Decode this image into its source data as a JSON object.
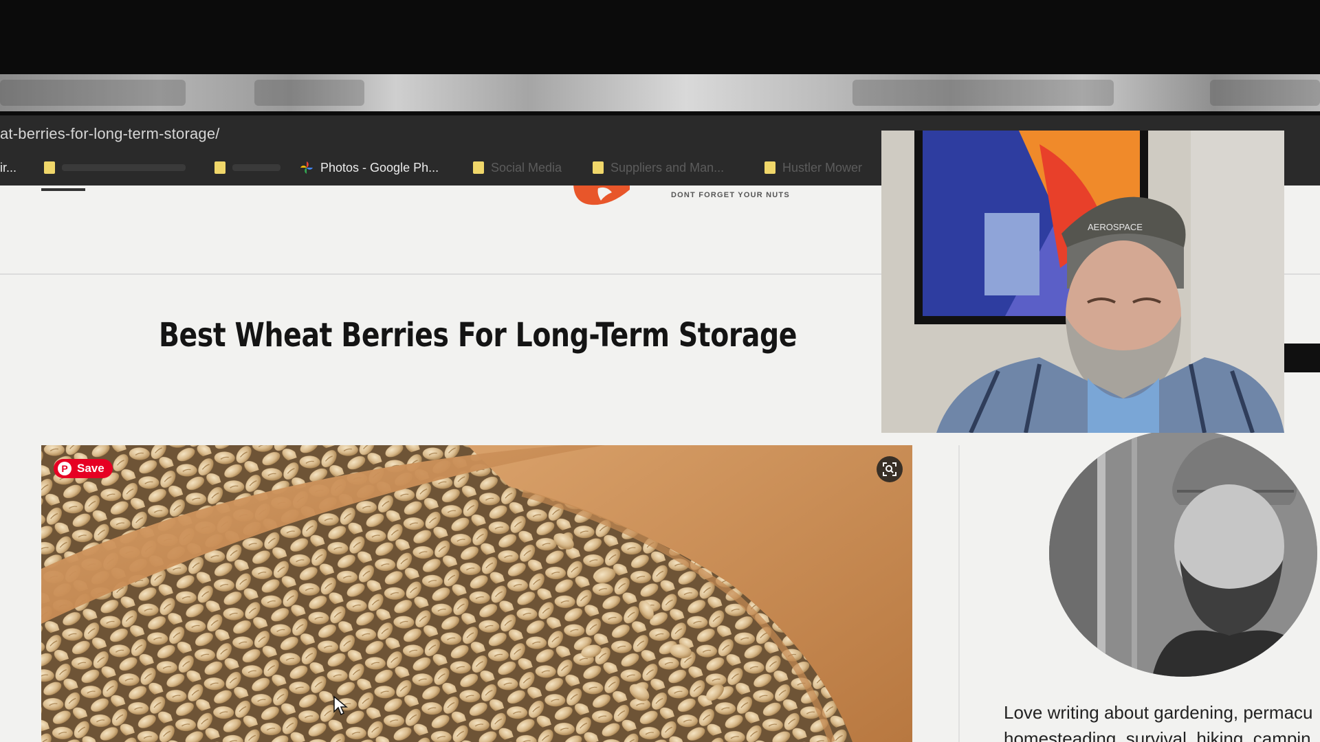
{
  "browser": {
    "url": "at-berries-for-long-term-storage/",
    "bookmarks": [
      {
        "label": "ir...",
        "type": "text",
        "visible": true
      },
      {
        "label": "Photos - Google Ph...",
        "type": "photos",
        "visible": true
      },
      {
        "label": "Social Media",
        "type": "folder",
        "visible": false
      },
      {
        "label": "Suppliers and Man...",
        "type": "folder",
        "visible": false
      },
      {
        "label": "Hustler Mower",
        "type": "folder",
        "visible": false
      }
    ]
  },
  "site": {
    "tagline": "DONT FORGET YOUR NUTS",
    "brand_color": "#e8562a"
  },
  "article": {
    "title": "Best Wheat Berries For Long-Term Storage",
    "save_label": "Save"
  },
  "sidebar": {
    "bio_line1": "Love writing about gardening, permacu",
    "bio_line2": "homesteading, survival, hiking, campin"
  },
  "overlay": {
    "cap_text": "AEROSPACE"
  },
  "colors": {
    "pinterest_red": "#e60023",
    "page_bg": "#f2f2f0",
    "chrome_dark": "#2a2a2a"
  }
}
